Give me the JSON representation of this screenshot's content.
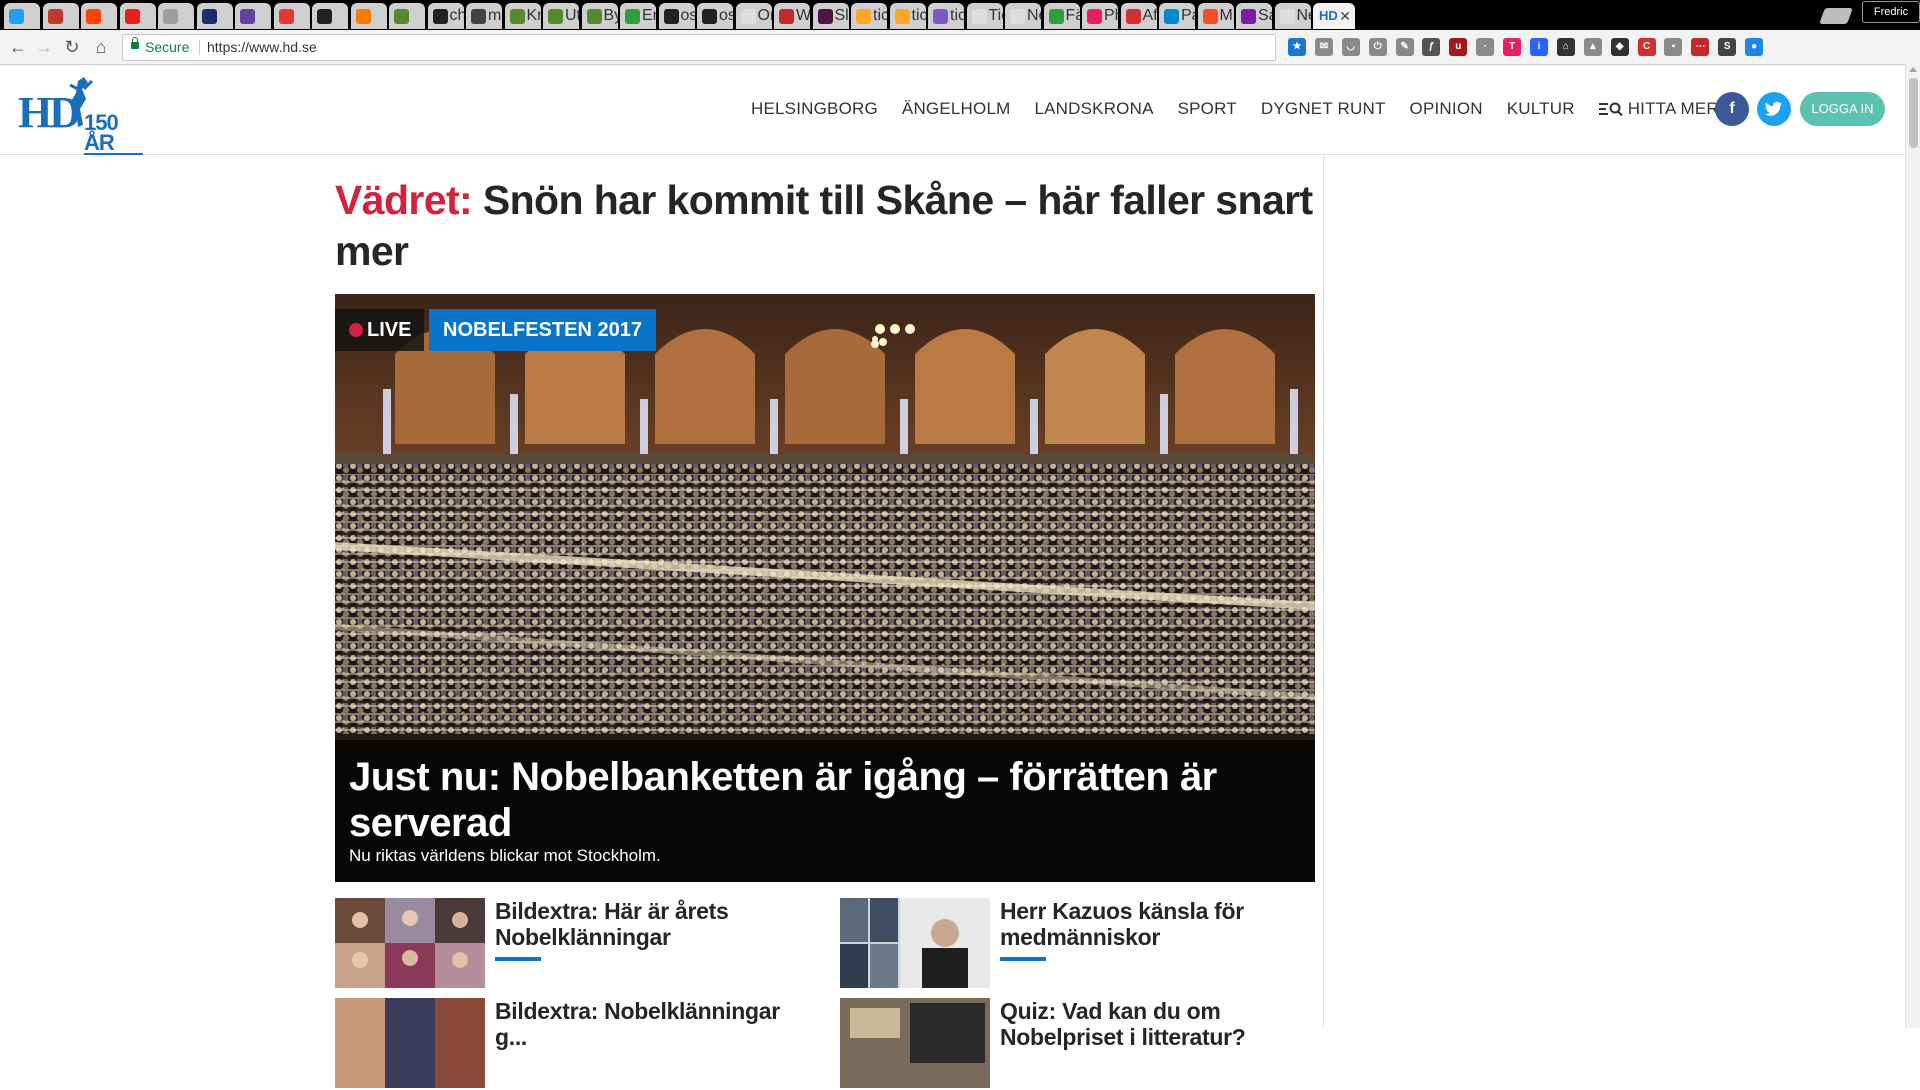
{
  "browser": {
    "tabs": [
      {
        "label": "",
        "color": "#1da1f2"
      },
      {
        "label": "",
        "color": "#c0392b"
      },
      {
        "label": "",
        "color": "#ff4500"
      },
      {
        "label": "",
        "color": "#e62117"
      },
      {
        "label": "",
        "color": "#9e9e9e"
      },
      {
        "label": "",
        "color": "#1e2d6b"
      },
      {
        "label": "",
        "color": "#6441a4"
      },
      {
        "label": "",
        "color": "#e53935"
      },
      {
        "label": "",
        "color": "#222222"
      },
      {
        "label": "",
        "color": "#f57c00"
      },
      {
        "label": "",
        "color": "#558b2f"
      },
      {
        "label": "ch",
        "color": "#222222"
      },
      {
        "label": "mc",
        "color": "#444444"
      },
      {
        "label": "Kn",
        "color": "#558b2f"
      },
      {
        "label": "Utv",
        "color": "#558b2f"
      },
      {
        "label": "By",
        "color": "#558b2f"
      },
      {
        "label": "En",
        "color": "#2e9e3e"
      },
      {
        "label": "os",
        "color": "#222222"
      },
      {
        "label": "os",
        "color": "#222222"
      },
      {
        "label": "On",
        "color": "#dddddd"
      },
      {
        "label": "Wi",
        "color": "#c62828"
      },
      {
        "label": "Sla",
        "color": "#4a154b"
      },
      {
        "label": "tic",
        "color": "#f9a825"
      },
      {
        "label": "tic",
        "color": "#f9a825"
      },
      {
        "label": "tic",
        "color": "#7e57c2"
      },
      {
        "label": "Tic",
        "color": "#dddddd"
      },
      {
        "label": "New T",
        "color": "#dddddd"
      },
      {
        "label": "Fä",
        "color": "#2e9e3e"
      },
      {
        "label": "Ph",
        "color": "#e91e63"
      },
      {
        "label": "Aft",
        "color": "#d32f2f"
      },
      {
        "label": "Pa",
        "color": "#0288d1"
      },
      {
        "label": "Mi",
        "color": "#f25022"
      },
      {
        "label": "Sa",
        "color": "#7b1fa2"
      },
      {
        "label": "New",
        "color": "#dddddd"
      }
    ],
    "active_tab": {
      "label": "HD",
      "close_glyph": "✕"
    },
    "profile_name": "Fredric",
    "secure_label": "Secure",
    "url": "https://www.hd.se",
    "extensions": [
      {
        "name": "bookmark-star-icon",
        "color": "#1976d2",
        "glyph": "★"
      },
      {
        "name": "mail-icon",
        "color": "#8a8a8a",
        "glyph": "✉"
      },
      {
        "name": "pocket-icon",
        "color": "#8a8a8a",
        "glyph": "◡"
      },
      {
        "name": "power-icon",
        "color": "#8a8a8a",
        "glyph": "⏻"
      },
      {
        "name": "pen-icon",
        "color": "#8a8a8a",
        "glyph": "✎"
      },
      {
        "name": "formula-icon",
        "color": "#555555",
        "glyph": "ƒ"
      },
      {
        "name": "ublock-icon",
        "color": "#a11b1b",
        "glyph": "u"
      },
      {
        "name": "ghost-icon",
        "color": "#8a8a8a",
        "glyph": "·"
      },
      {
        "name": "t-icon",
        "color": "#e91e63",
        "glyph": "T"
      },
      {
        "name": "info-icon",
        "color": "#2962ff",
        "glyph": "i"
      },
      {
        "name": "hat-icon",
        "color": "#333333",
        "glyph": "⌂"
      },
      {
        "name": "triangle-icon",
        "color": "#8a8a8a",
        "glyph": "▲"
      },
      {
        "name": "shield-icon",
        "color": "#333333",
        "glyph": "◆"
      },
      {
        "name": "cors-icon",
        "color": "#d32f2f",
        "glyph": "C"
      },
      {
        "name": "chat-icon",
        "color": "#8a8a8a",
        "glyph": "▪"
      },
      {
        "name": "dots-icon",
        "color": "#c62828",
        "glyph": "⋯"
      },
      {
        "name": "s-icon",
        "color": "#444444",
        "glyph": "S"
      },
      {
        "name": "camera-icon",
        "color": "#1e88e5",
        "glyph": "●"
      }
    ]
  },
  "site": {
    "logo": {
      "letters": "HD",
      "years": "150 ÅR",
      "color": "#1a6fbd"
    },
    "nav": [
      "HELSINGBORG",
      "ÄNGELHOLM",
      "LANDSKRONA",
      "SPORT",
      "DYGNET RUNT",
      "OPINION",
      "KULTUR"
    ],
    "nav_more": "HITTA MER",
    "social": {
      "facebook": "f",
      "twitter": "t"
    },
    "login": "LOGGA IN"
  },
  "main": {
    "top_headline": {
      "kicker": "Vädret:",
      "text": "Snön har kommit till Skåne – här faller snart mer"
    },
    "hero": {
      "live": "LIVE",
      "section": "NOBELFESTEN 2017",
      "title": "Just nu: Nobelbanketten är igång – förrätten är serverad",
      "lead": "Nu riktas världens blickar mot Stockholm."
    },
    "teasers": [
      {
        "title": "Bildextra: Här är årets Nobelklänningar"
      },
      {
        "title": "Herr Kazuos känsla för medmänniskor"
      },
      {
        "title": "Bildextra: Nobelklänningar g..."
      },
      {
        "title": "Quiz: Vad kan du om Nobelpriset i litteratur?"
      }
    ]
  },
  "colors": {
    "kicker": "#d4213d",
    "brand_blue": "#0a74c9",
    "login": "#5bc2b2",
    "facebook": "#3b5998",
    "twitter": "#1da1f2"
  }
}
